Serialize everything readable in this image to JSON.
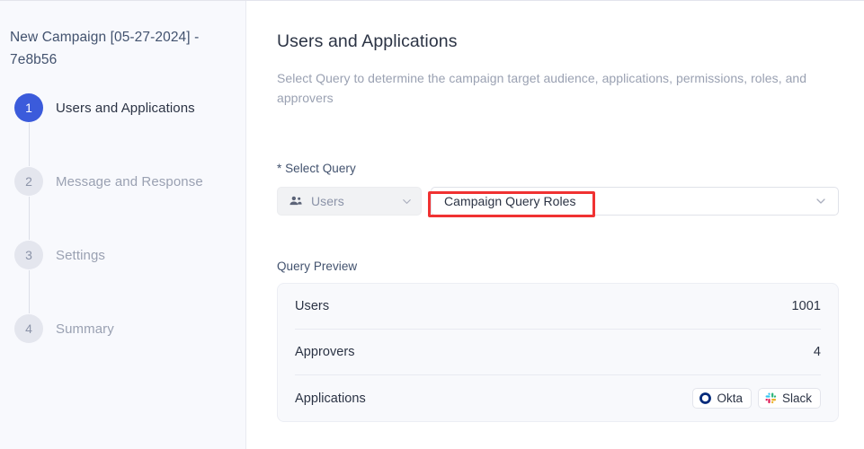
{
  "sidebar": {
    "campaign_title": "New Campaign [05-27-2024] - 7e8b56",
    "steps": [
      {
        "number": "1",
        "label": "Users and Applications",
        "state": "active"
      },
      {
        "number": "2",
        "label": "Message and Response",
        "state": "inactive"
      },
      {
        "number": "3",
        "label": "Settings",
        "state": "inactive"
      },
      {
        "number": "4",
        "label": "Summary",
        "state": "inactive"
      }
    ]
  },
  "main": {
    "title": "Users and Applications",
    "subtitle": "Select Query to determine the campaign target audience, applications, permissions, roles, and approvers",
    "select_query": {
      "label": "* Select Query",
      "entity_select": {
        "value": "Users",
        "icon": "people-group-icon",
        "chevron": "chevron-down-icon"
      },
      "query_select": {
        "value": "Campaign Query Roles",
        "placeholder": "Select query",
        "chevron": "chevron-down-icon"
      }
    },
    "query_preview": {
      "label": "Query Preview",
      "rows": [
        {
          "key": "Users",
          "value": "1001",
          "type": "number"
        },
        {
          "key": "Approvers",
          "value": "4",
          "type": "number"
        },
        {
          "key": "Applications",
          "value": "",
          "type": "apps"
        }
      ],
      "applications": [
        {
          "name": "Okta",
          "icon": "okta-icon"
        },
        {
          "name": "Slack",
          "icon": "slack-icon"
        }
      ]
    }
  },
  "annotation": {
    "present": true,
    "target": "Campaign Query Roles",
    "color": "#f03232"
  },
  "theme": {
    "accent": "#3b5bdb",
    "sidebar_bg": "#f8f9fd",
    "card_bg": "#f8f9fc",
    "text_primary": "#2b3344",
    "text_muted": "#9aa1b2",
    "okta_blue": "#00297a",
    "slack_colors": [
      "#36c5f0",
      "#2eb67d",
      "#ecb22e",
      "#e01e5a"
    ]
  }
}
